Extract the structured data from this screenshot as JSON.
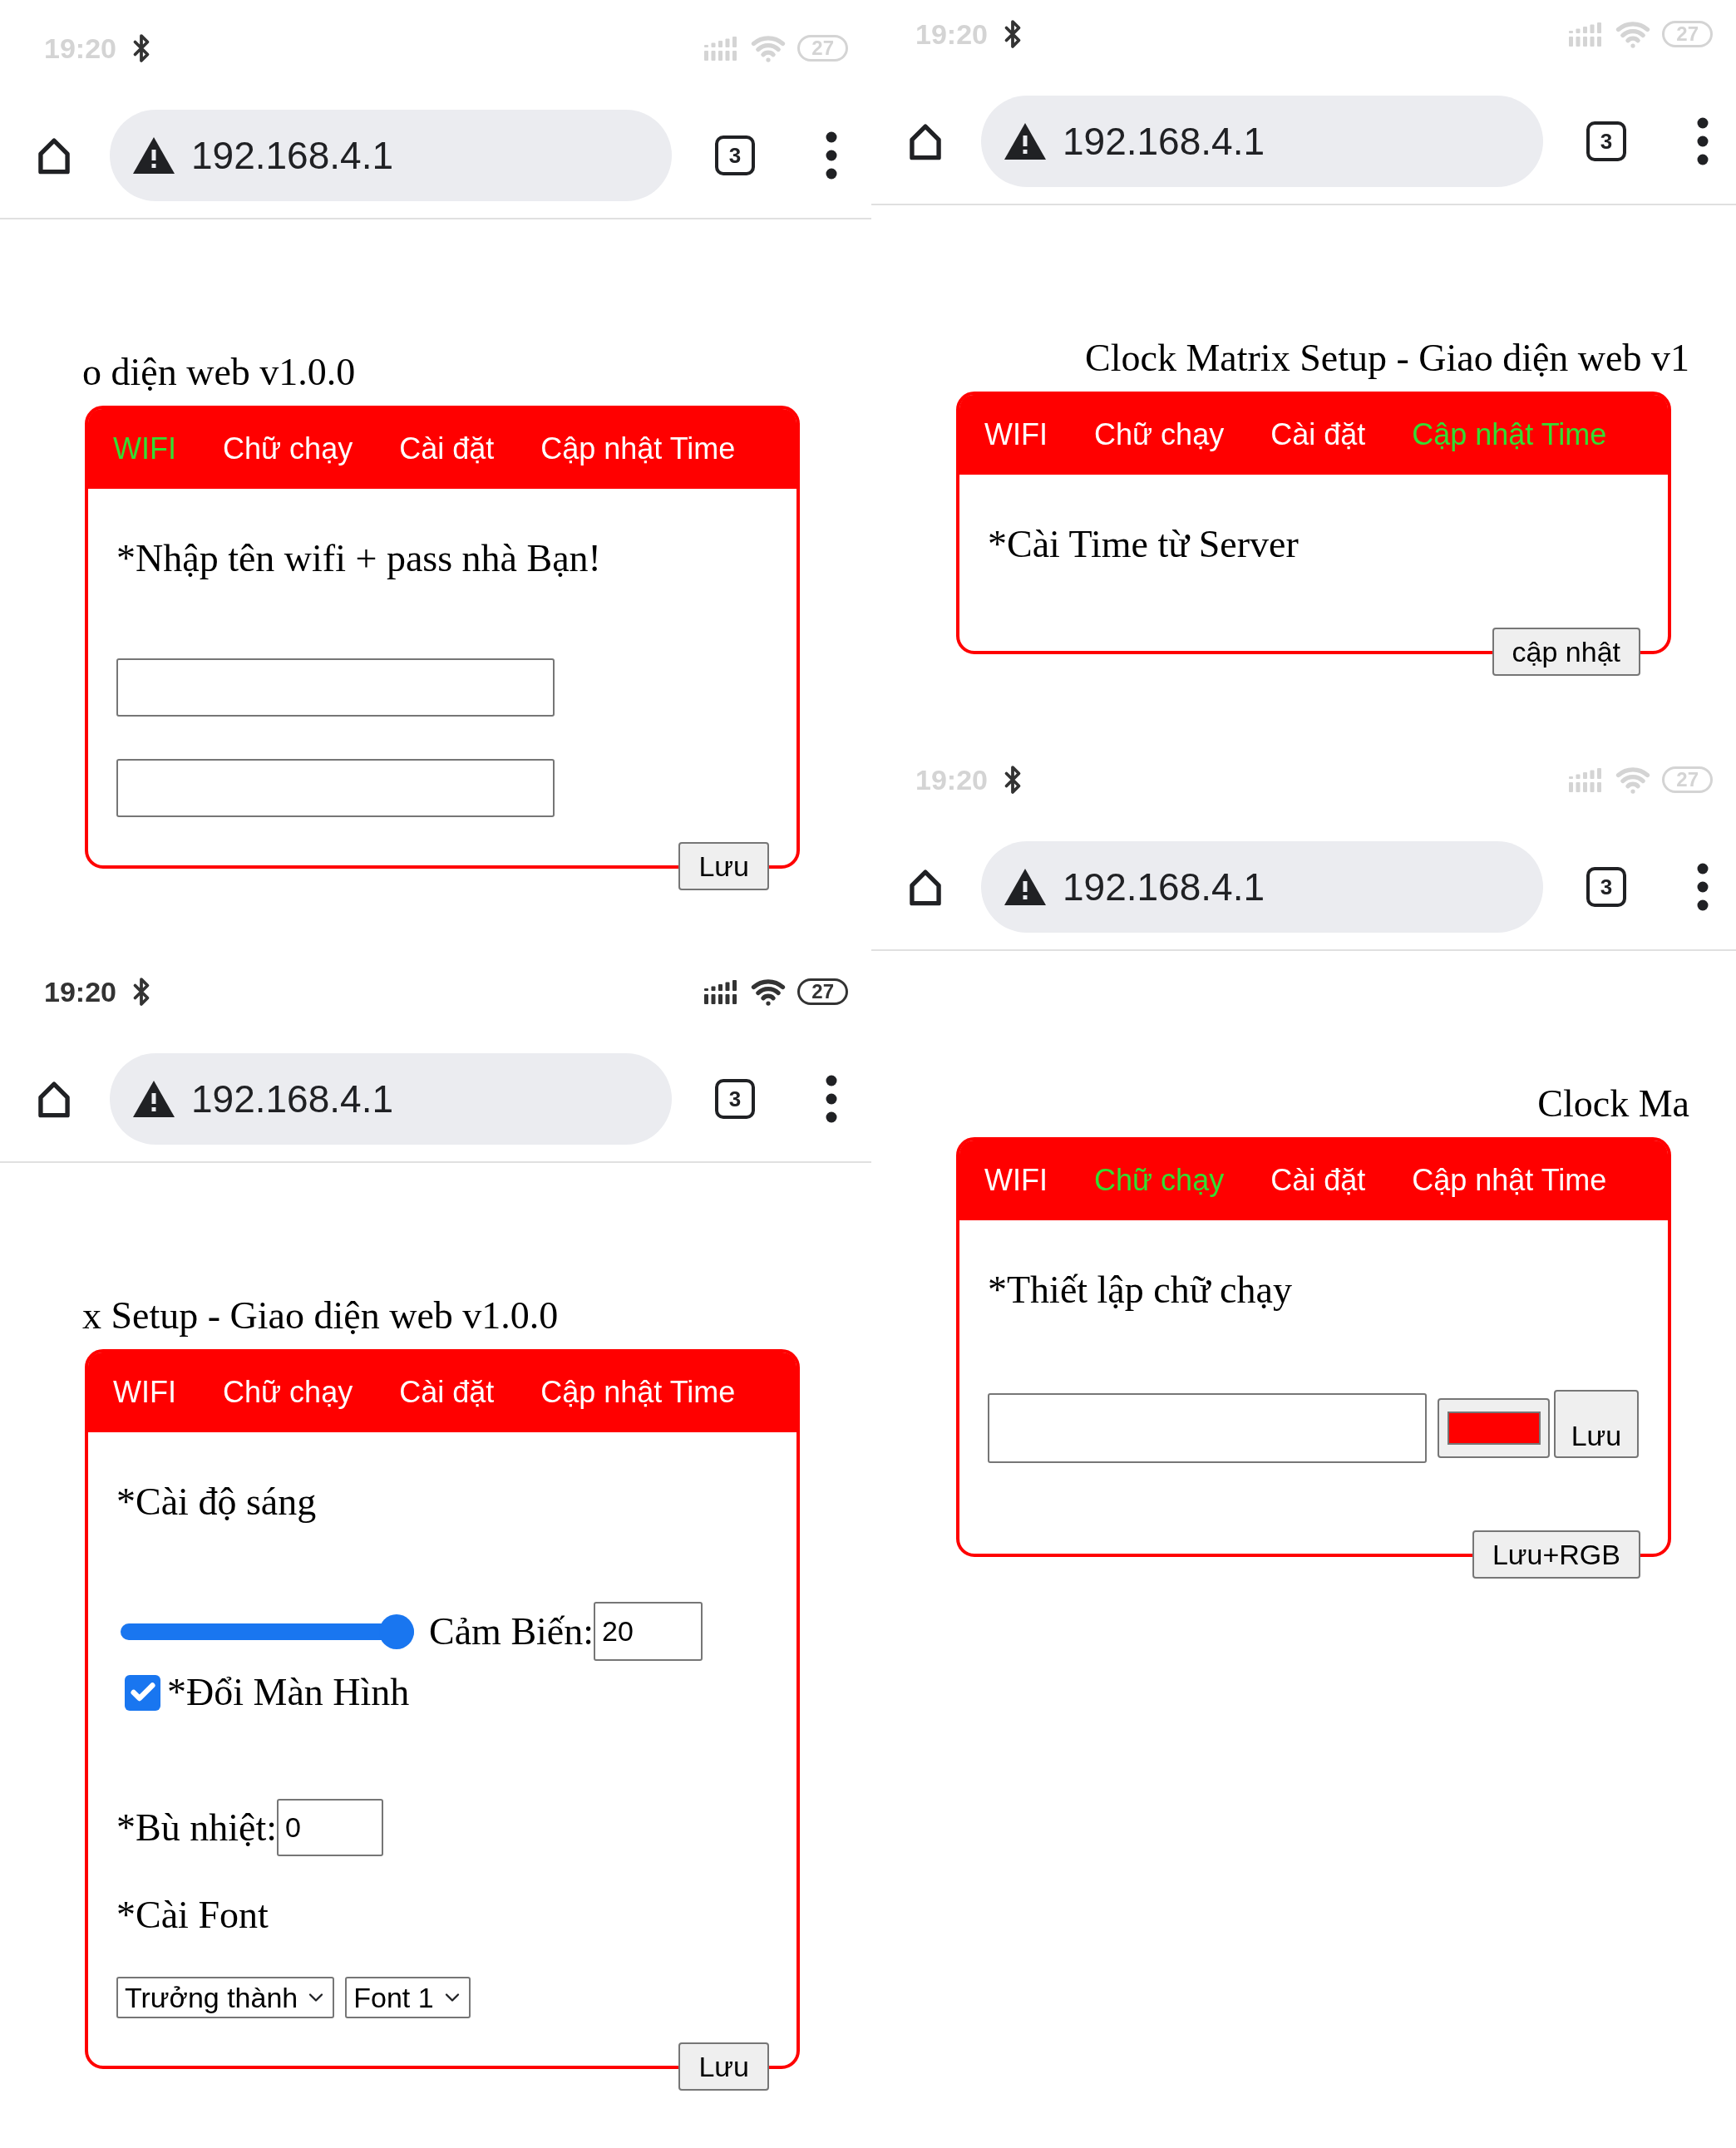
{
  "columns": [
    {
      "screens": [
        {
          "status_bar": {
            "time": "19:20",
            "battery": "27",
            "dimmed": true
          },
          "toolbar": {
            "url": "192.168.4.1",
            "tab_count": "3"
          },
          "page": {
            "title": "o diện web v1.0.0",
            "tabs": [
              {
                "label": "WIFI",
                "selected": true
              },
              {
                "label": "Chữ chạy",
                "selected": false
              },
              {
                "label": "Cài đặt",
                "selected": false
              },
              {
                "label": "Cập nhật Time",
                "selected": false
              }
            ],
            "section": {
              "kind": "wifi",
              "heading": "*Nhập tên wifi + pass nhà Bạn!",
              "rows": [
                {
                  "kind": "input"
                },
                {
                  "kind": "input"
                }
              ],
              "footer_button": "Lưu"
            }
          }
        },
        {
          "status_bar": {
            "time": "19:20",
            "battery": "27",
            "dimmed": false
          },
          "toolbar": {
            "url": "192.168.4.1",
            "tab_count": "3"
          },
          "page": {
            "title": "x Setup - Giao diện web v1.0.0",
            "tabs": [
              {
                "label": "WIFI",
                "selected": false
              },
              {
                "label": "Chữ chạy",
                "selected": false
              },
              {
                "label": "Cài đặt",
                "selected": false
              },
              {
                "label": "Cập nhật Time",
                "selected": false
              }
            ],
            "section": {
              "kind": "settings",
              "heading": "*Cài độ sáng",
              "rows": [
                {
                  "kind": "slider",
                  "level": 1,
                  "label": "Cảm Biến:",
                  "value": "20"
                },
                {
                  "kind": "checkbox",
                  "checked": true,
                  "label": "*Đổi Màn Hình"
                },
                {
                  "kind": "number",
                  "label": "*Bù nhiệt:",
                  "value": "0"
                },
                {
                  "kind": "subheading",
                  "label": "*Cài Font"
                },
                {
                  "kind": "selects",
                  "selects": [
                    {
                      "value": "Trưởng thành"
                    },
                    {
                      "value": "Font 1"
                    }
                  ]
                }
              ],
              "footer_button": "Lưu"
            }
          }
        }
      ]
    },
    {
      "screens": [
        {
          "status_bar": {
            "time": "19:20",
            "battery": "27",
            "dimmed": true
          },
          "toolbar": {
            "url": "192.168.4.1",
            "tab_count": "3"
          },
          "page": {
            "title": "Clock Matrix Setup - Giao diện web v1",
            "tabs": [
              {
                "label": "WIFI",
                "selected": false
              },
              {
                "label": "Chữ chạy",
                "selected": false
              },
              {
                "label": "Cài đặt",
                "selected": false
              },
              {
                "label": "Cập nhật Time",
                "selected": true
              }
            ],
            "section": {
              "kind": "time",
              "heading": "*Cài Time từ Server",
              "footer_button": "cập nhật"
            }
          }
        },
        {
          "status_bar": {
            "time": "19:20",
            "battery": "27",
            "dimmed": true
          },
          "toolbar": {
            "url": "192.168.4.1",
            "tab_count": "3"
          },
          "page": {
            "title": "Clock Ma",
            "tabs": [
              {
                "label": "WIFI",
                "selected": false
              },
              {
                "label": "Chữ chạy",
                "selected": true
              },
              {
                "label": "Cài đặt",
                "selected": false
              },
              {
                "label": "Cập nhật Time",
                "selected": false
              }
            ],
            "section": {
              "kind": "text",
              "heading": "*Thiết lập chữ chạy",
              "rows": [
                {
                  "kind": "text_color",
                  "color": "#ff0000",
                  "button": "Lưu"
                }
              ],
              "footer_button": "Lưu+RGB"
            }
          }
        }
      ]
    }
  ]
}
